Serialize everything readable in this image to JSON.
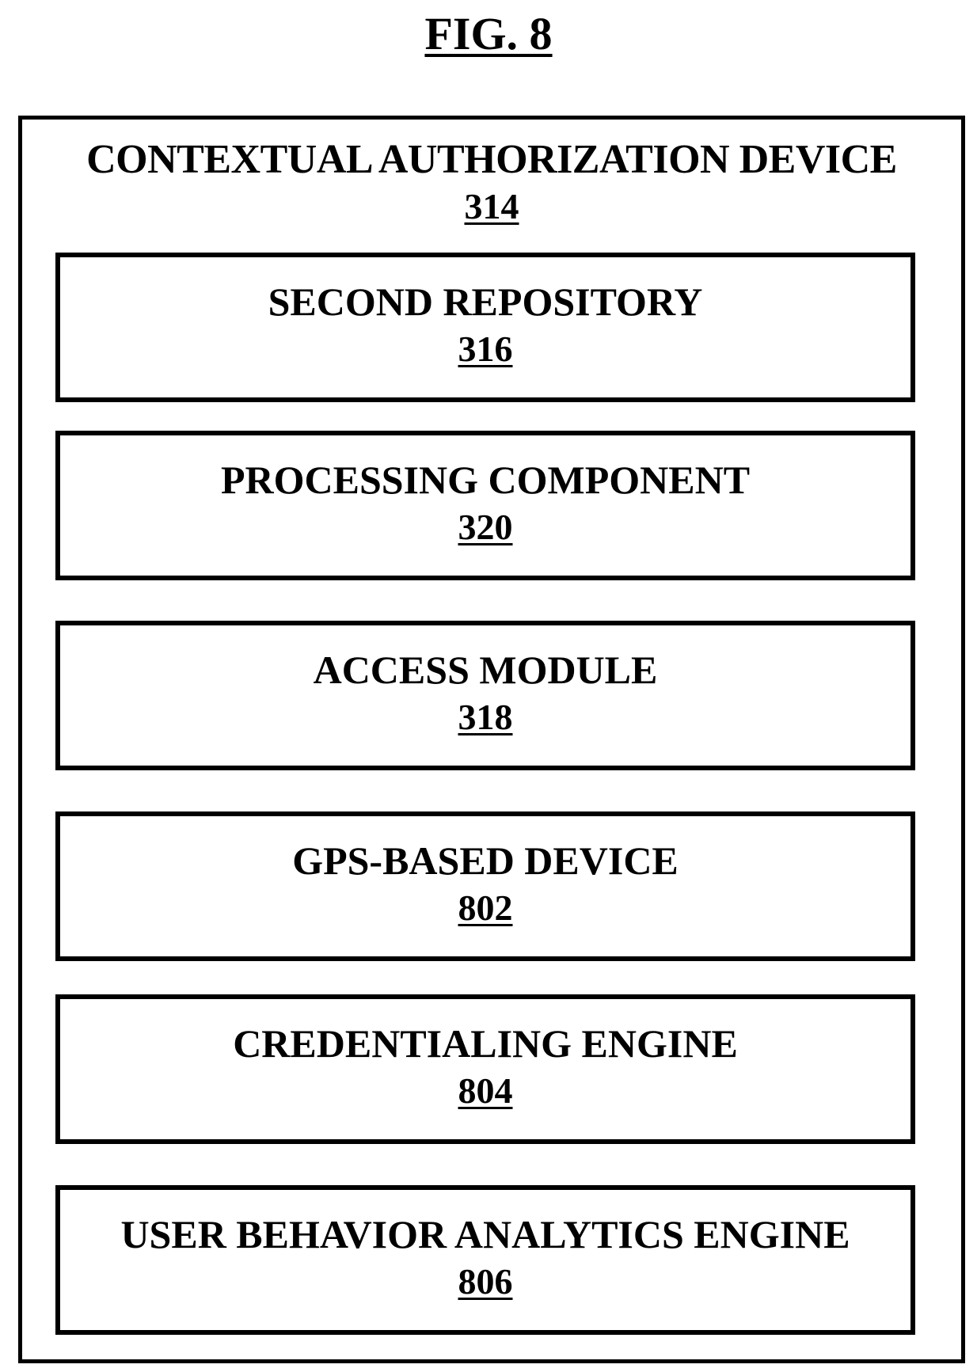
{
  "figure": {
    "title": "FIG. 8"
  },
  "device": {
    "label": "CONTEXTUAL AUTHORIZATION DEVICE",
    "number": "314"
  },
  "components": [
    {
      "label": "SECOND REPOSITORY",
      "number": "316"
    },
    {
      "label": "PROCESSING COMPONENT",
      "number": "320"
    },
    {
      "label": "ACCESS MODULE",
      "number": "318"
    },
    {
      "label": "GPS-BASED DEVICE",
      "number": "802"
    },
    {
      "label": "CREDENTIALING ENGINE",
      "number": "804"
    },
    {
      "label": "USER BEHAVIOR ANALYTICS ENGINE",
      "number": "806"
    }
  ]
}
